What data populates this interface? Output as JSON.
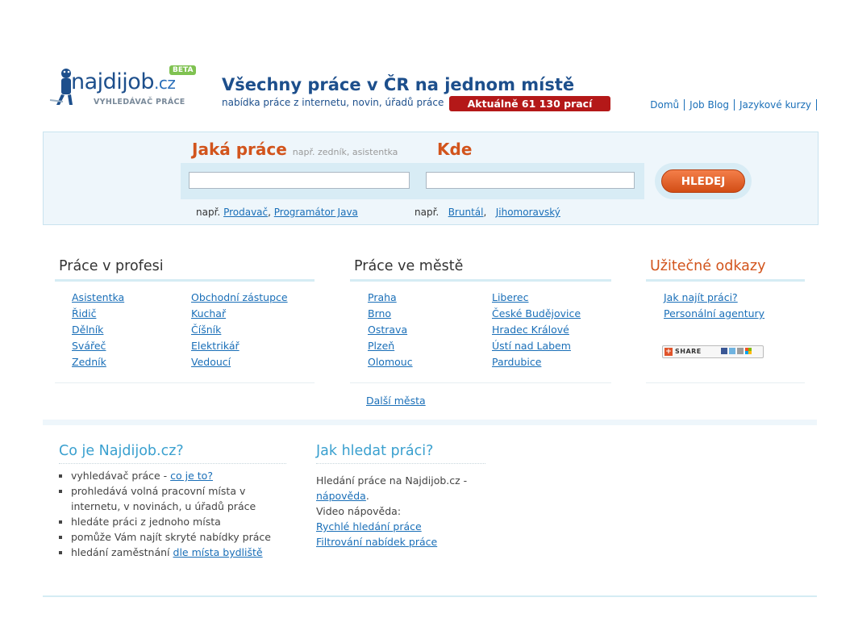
{
  "header": {
    "logo_text": "najdijob",
    "logo_cz": ".cz",
    "logo_beta": "BETA",
    "logo_sub": "VYHLEDÁVAČ PRÁCE",
    "tagline": "Všechny práce v ČR na jednom místě",
    "subtagline": "nabídka práce z internetu, novin, úřadů práce",
    "badge": "Aktuálně 61 130 prací",
    "nav": [
      "Domů",
      "Job Blog",
      "Jazykové kurzy"
    ]
  },
  "search": {
    "what_label": "Jaká práce",
    "what_hint": "např. zedník, asistentka",
    "where_label": "Kde",
    "what_value": "",
    "where_value": "",
    "button": "HLEDEJ",
    "ex_prefix": "např.",
    "what_examples": [
      "Prodavač",
      "Programátor Java"
    ],
    "where_examples": [
      "Bruntál",
      "Jihomoravský"
    ]
  },
  "profese": {
    "title": "Práce v profesi",
    "col1": [
      "Asistentka",
      "Řidič",
      "Dělník",
      "Svářeč",
      "Zedník"
    ],
    "col2": [
      "Obchodní zástupce",
      "Kuchař",
      "Číšník",
      "Elektrikář",
      "Vedoucí"
    ]
  },
  "mesta": {
    "title": "Práce ve městě",
    "col1": [
      "Praha",
      "Brno",
      "Ostrava",
      "Plzeň",
      "Olomouc"
    ],
    "col2": [
      "Liberec",
      "České Budějovice",
      "Hradec Králové",
      "Ústí nad Labem",
      "Pardubice"
    ],
    "more": "Další města"
  },
  "odkazy": {
    "title": "Užitečné odkazy",
    "items": [
      "Jak najít práci?",
      "Personální agentury"
    ],
    "share": "SHARE"
  },
  "about": {
    "title": "Co je Najdijob.cz?",
    "items": [
      {
        "text": "vyhledávač práce - ",
        "link": "co je to?"
      },
      {
        "text": "prohledává volná pracovní místa v internetu, v novinách, u úřadů práce",
        "link": ""
      },
      {
        "text": "hledáte práci z jednoho místa",
        "link": ""
      },
      {
        "text": "pomůže Vám najít skryté nabídky práce",
        "link": ""
      },
      {
        "text": "hledání zaměstnání ",
        "link": "dle místa bydliště"
      }
    ]
  },
  "howto": {
    "title": "Jak hledat práci?",
    "line1": "Hledání práce na Najdijob.cz -",
    "help_link": "nápověda",
    "line3": "Video nápověda:",
    "video_links": [
      "Rychlé hledání práce",
      "Filtrování nabídek práce"
    ]
  }
}
